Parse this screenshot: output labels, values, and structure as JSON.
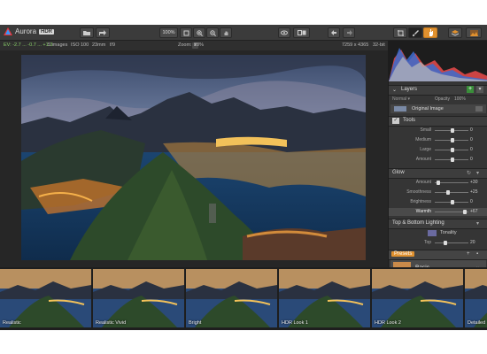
{
  "app": {
    "name": "Aurora",
    "badge": "HDR"
  },
  "toolbar": {
    "zoom_100": "100%",
    "zoom_label": "Zoom:",
    "zoom_value": "28%"
  },
  "info": {
    "ev": "EV: -2.7 ... -0.7 ... +1.3",
    "images": "5 images",
    "iso": "ISO 100",
    "focal": "23mm",
    "aperture": "f/9",
    "size": "7259 x 4365",
    "bits": "32-bit"
  },
  "layers": {
    "title": "Layers",
    "blend": "Normal",
    "opacity_label": "Opacity",
    "opacity_value": "100%",
    "original": "Original Image"
  },
  "tools": {
    "title": "Tools",
    "rows": [
      {
        "label": "Small",
        "value": "0"
      },
      {
        "label": "Medium",
        "value": "0"
      },
      {
        "label": "Large",
        "value": "0"
      },
      {
        "label": "Amount",
        "value": "0"
      }
    ]
  },
  "glow": {
    "title": "Glow",
    "rows": [
      {
        "label": "Amount",
        "value": "+30"
      },
      {
        "label": "Smoothness",
        "value": "+25"
      },
      {
        "label": "Brightness",
        "value": "0"
      },
      {
        "label": "Warmth",
        "value": "+67"
      }
    ]
  },
  "topbottom": {
    "title": "Top & Bottom Lighting",
    "tonality": "Tonality",
    "top_label": "Top",
    "top_value": "20"
  },
  "presets": {
    "title": "Presets",
    "current": "Basic"
  },
  "filmstrip": [
    {
      "label": "Realistic"
    },
    {
      "label": "Realistic Vivid"
    },
    {
      "label": "Bright"
    },
    {
      "label": "HDR Look 1"
    },
    {
      "label": "HDR Look 2"
    },
    {
      "label": "Detailed"
    }
  ],
  "colors": {
    "accent": "#e0912f",
    "panel": "#353535",
    "toolbar": "#3b3b3b"
  }
}
